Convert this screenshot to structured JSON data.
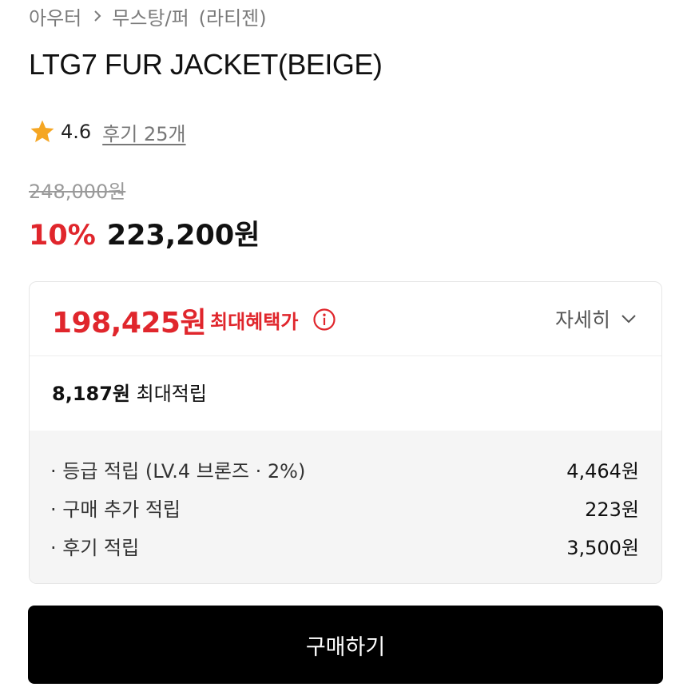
{
  "breadcrumb": {
    "category": "아우터",
    "separator_icon": "chevron-right-icon",
    "subcategory": "무스탕/퍼",
    "brand": "(라티젠)"
  },
  "product": {
    "title": "LTG7 FUR JACKET(BEIGE)"
  },
  "rating": {
    "star_icon": "star-icon",
    "star_color": "#F5A623",
    "score": "4.6",
    "reviews": "후기 25개"
  },
  "price": {
    "original": "248,000원",
    "discount_percent": "10%",
    "sale": "223,200원",
    "accent_color": "#E0262C"
  },
  "benefit_card": {
    "best_price": "198,425원",
    "best_label": "최대혜택가",
    "info_icon": "info-icon",
    "detail_label": "자세히",
    "detail_icon": "chevron-down-icon",
    "points_amount": "8,187원",
    "points_label": "최대적립",
    "items": [
      {
        "label": "· 등급 적립 (LV.4 브론즈 · 2%)",
        "value": "4,464원"
      },
      {
        "label": "· 구매 추가 적립",
        "value": "223원"
      },
      {
        "label": "· 후기 적립",
        "value": "3,500원"
      }
    ]
  },
  "buy_button": {
    "label": "구매하기"
  }
}
